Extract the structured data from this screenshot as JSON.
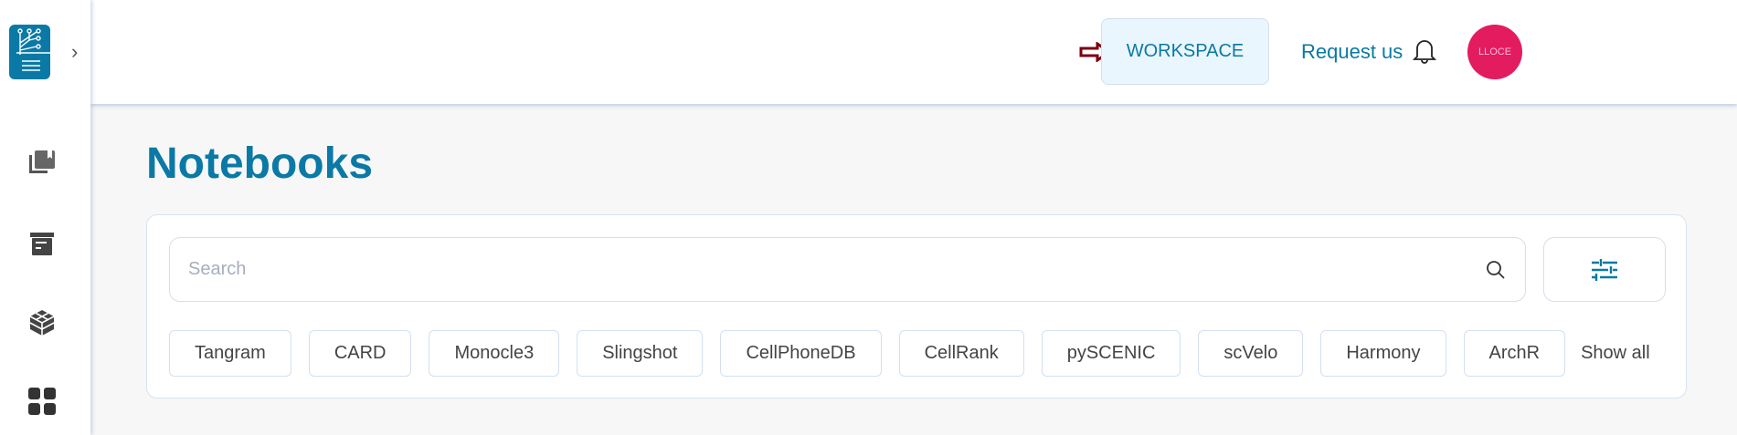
{
  "header": {
    "workspace_label": "WORKSPACE",
    "request_label": "Request us",
    "avatar_initials": "LLOCE"
  },
  "page": {
    "title": "Notebooks"
  },
  "search": {
    "placeholder": "Search",
    "value": ""
  },
  "chips": [
    "Tangram",
    "CARD",
    "Monocle3",
    "Slingshot",
    "CellPhoneDB",
    "CellRank",
    "pySCENIC",
    "scVelo",
    "Harmony",
    "ArchR"
  ],
  "show_all_label": "Show all",
  "colors": {
    "accent": "#0b79a5",
    "avatar": "#e31b5f",
    "arrow": "#7a0010"
  }
}
